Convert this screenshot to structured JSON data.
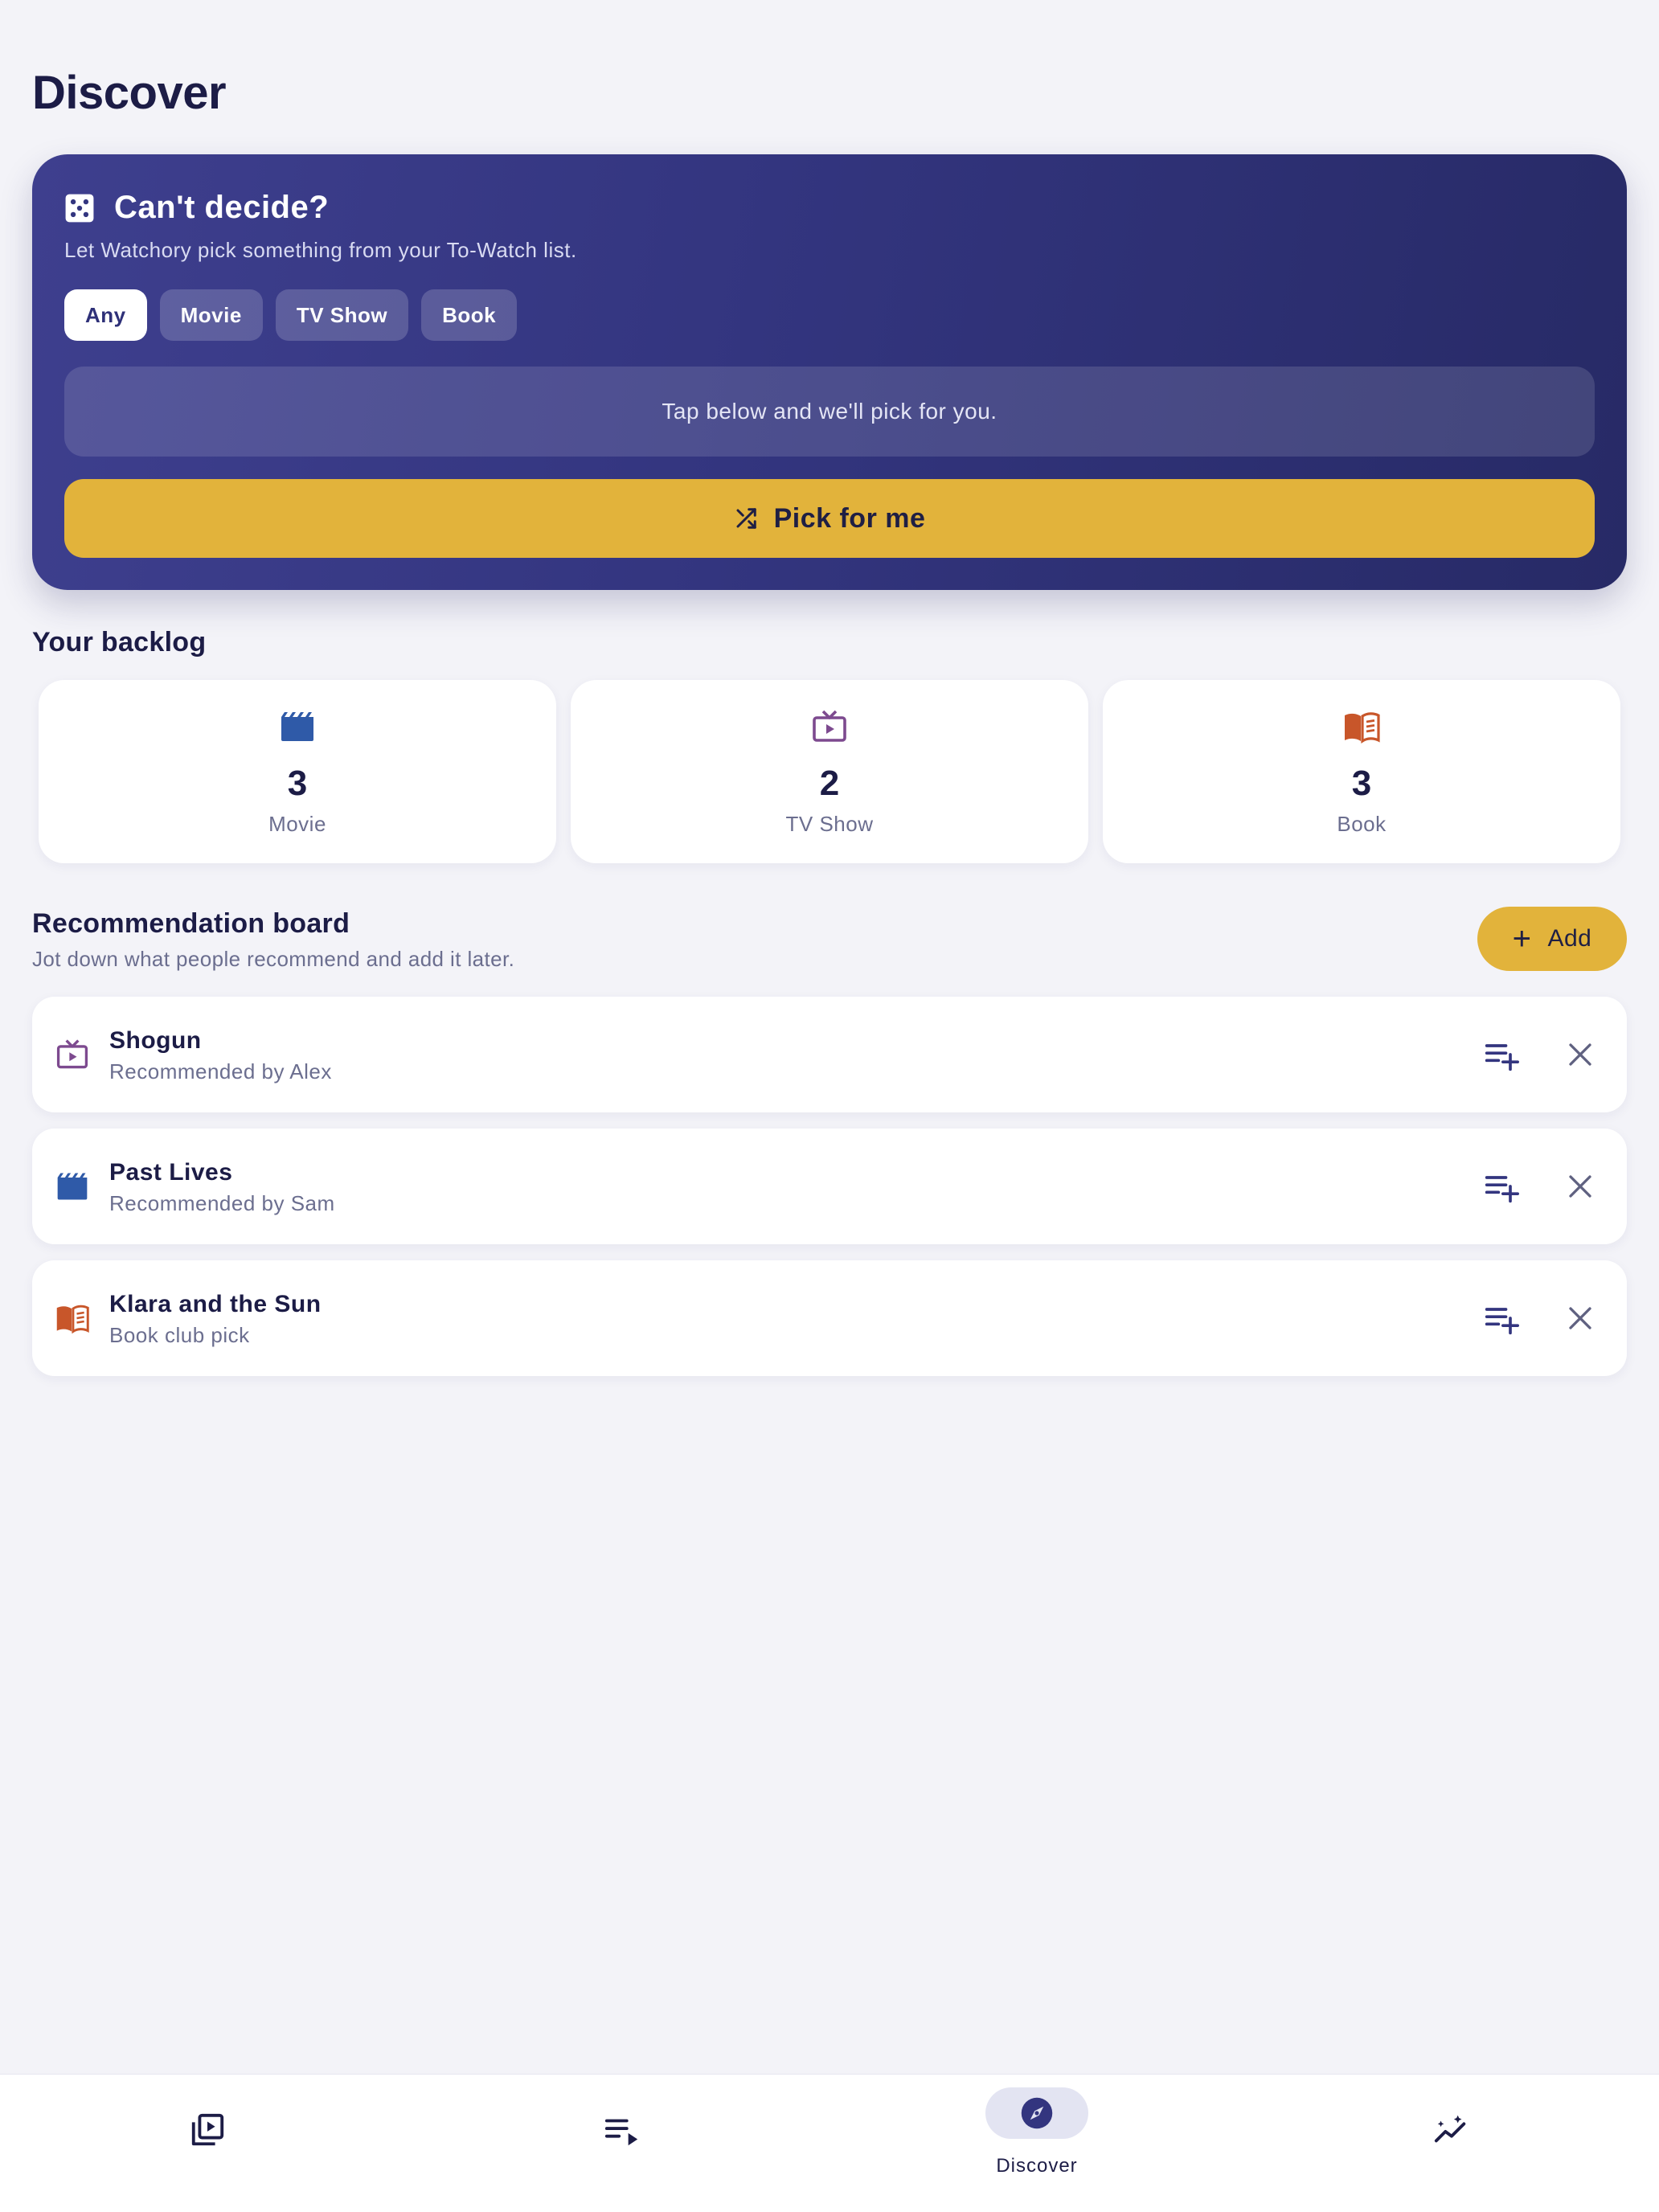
{
  "page": {
    "title": "Discover"
  },
  "hero": {
    "title": "Can't decide?",
    "subtitle": "Let Watchory pick something from your To-Watch list.",
    "filters": [
      "Any",
      "Movie",
      "TV Show",
      "Book"
    ],
    "selected_filter": "Any",
    "hint": "Tap below and we'll pick for you.",
    "pick_button": "Pick for me",
    "colors": {
      "accent": "#e2b33b",
      "gradient_start": "#3e3f8e",
      "gradient_end": "#272a66"
    }
  },
  "backlog": {
    "title": "Your backlog",
    "items": [
      {
        "icon": "movie-clapper-icon",
        "count": "3",
        "label": "Movie",
        "color": "#2f5aa8"
      },
      {
        "icon": "tv-icon",
        "count": "2",
        "label": "TV Show",
        "color": "#7d4a8f"
      },
      {
        "icon": "book-icon",
        "count": "3",
        "label": "Book",
        "color": "#c8562a"
      }
    ]
  },
  "recommendations": {
    "title": "Recommendation board",
    "subtitle": "Jot down what people recommend and add it later.",
    "add_label": "Add",
    "items": [
      {
        "icon": "tv-icon",
        "title": "Shogun",
        "note": "Recommended by Alex"
      },
      {
        "icon": "movie-clapper-icon",
        "title": "Past Lives",
        "note": "Recommended by Sam"
      },
      {
        "icon": "book-icon",
        "title": "Klara and the Sun",
        "note": "Book club pick"
      }
    ]
  },
  "nav": {
    "items": [
      {
        "icon": "library-icon",
        "label": ""
      },
      {
        "icon": "queue-icon",
        "label": ""
      },
      {
        "icon": "compass-icon",
        "label": "Discover",
        "active": true
      },
      {
        "icon": "insights-icon",
        "label": ""
      }
    ]
  }
}
